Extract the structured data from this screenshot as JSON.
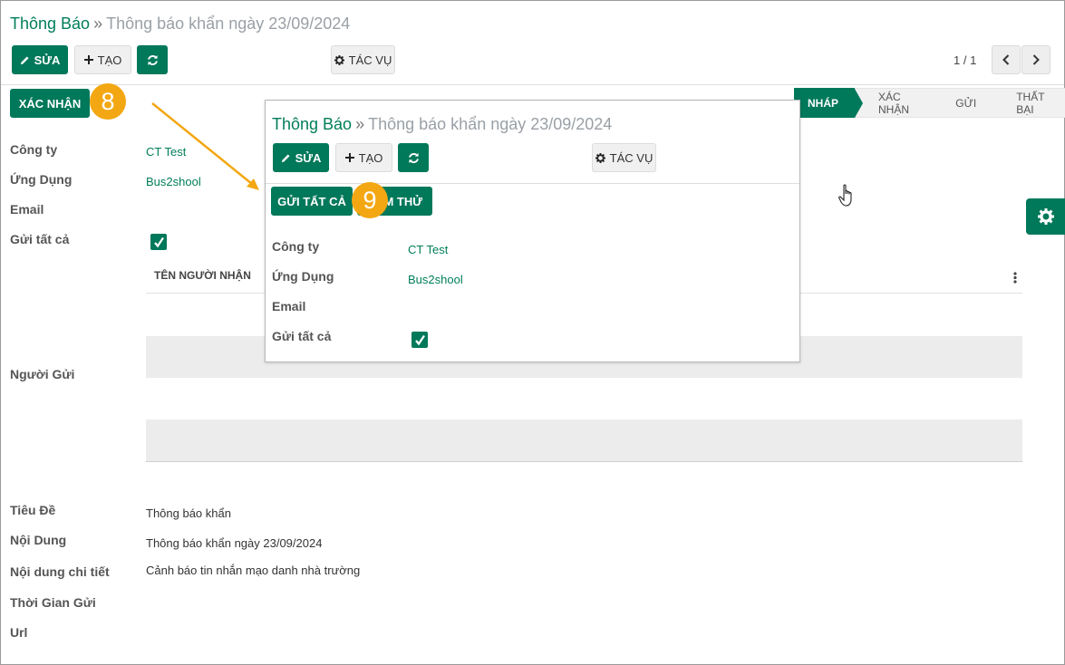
{
  "breadcrumb": {
    "parent": "Thông Báo",
    "separator": "»",
    "current": "Thông báo khẩn ngày 23/09/2024"
  },
  "toolbar": {
    "edit_label": "SỬA",
    "create_label": "TẠO",
    "action_label": "TÁC VỤ"
  },
  "pager": {
    "text": "1 / 1"
  },
  "confirm_button": "XÁC NHẬN",
  "step_badges": {
    "first": "8",
    "second": "9"
  },
  "status_stages": [
    {
      "label": "NHÁP",
      "active": true
    },
    {
      "label": "XÁC NHẬN",
      "active": false
    },
    {
      "label": "GỬI",
      "active": false
    },
    {
      "label": "THẤT BẠI",
      "active": false
    }
  ],
  "form": {
    "company_label": "Công ty",
    "company_value": "CT Test",
    "app_label": "Ứng Dụng",
    "app_value": "Bus2shool",
    "email_label": "Email",
    "send_all_label": "Gửi tất cả",
    "send_all_checked": true,
    "recipient_column": "TÊN NGƯỜI NHẬN",
    "sender_label": "Người Gửi",
    "title_label": "Tiêu Đề",
    "title_value": "Thông báo khẩn",
    "content_label": "Nội Dung",
    "content_value": "Thông báo khẩn ngày 23/09/2024",
    "detail_label": "Nội dung chi tiết",
    "detail_value": "Cảnh báo tin nhắn mạo danh nhà trường",
    "send_time_label": "Thời Gian Gửi",
    "url_label": "Url"
  },
  "popup": {
    "send_all_button": "GỬI TẤT CẢ",
    "test_send_button": "GỬI THỬ",
    "test_send_visible": "M THỬ"
  },
  "colors": {
    "primary": "#00785a",
    "badge": "#f3a712",
    "link": "#017e5a"
  },
  "icons": [
    "pencil-icon",
    "plus-icon",
    "refresh-icon",
    "gear-icon",
    "chevron-left-icon",
    "chevron-right-icon",
    "kebab-icon",
    "checkmark-icon",
    "hand-cursor-icon"
  ]
}
